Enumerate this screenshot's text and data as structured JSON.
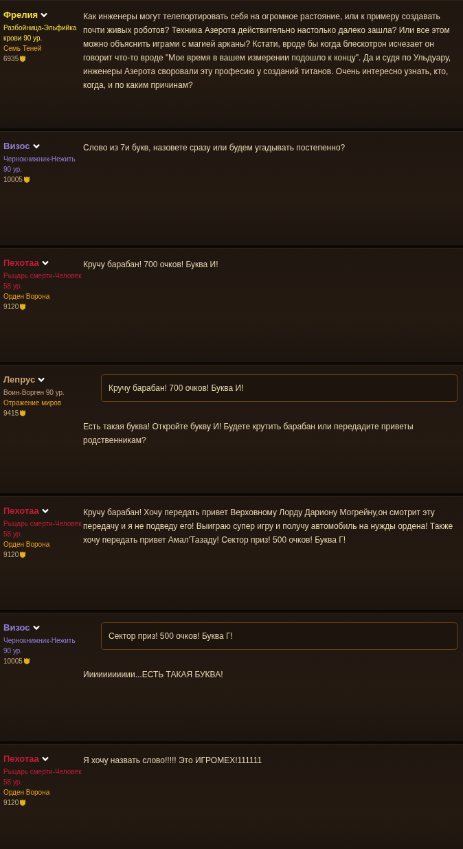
{
  "posts": [
    {
      "author": {
        "name": "Фрелия",
        "color": "#f5e04a",
        "class": "Разбойница-Эльфийка крови 90 ур.",
        "guild": "Семь Теней",
        "points": "6935"
      },
      "body": "Как инженеры могут телепортировать себя на огромное растояние, или к примеру создавать почти живых роботов? Техника Азерота действительно настолько далеко зашла? Или все этом можно объяснить играми с магией арканы? Кстати, вроде бы когда блескотрон исчезает он говорит что-то вроде \"Мое время в вашем измерении подошло к концу\". Да и судя по Ульдуару, инженеры Азерота своровали эту професию у созданий титанов. Очень интересно узнать, кто, когда, и по каким причинам?"
    },
    {
      "author": {
        "name": "Визос",
        "color": "#8f7fd6",
        "class": "Чернокнижник-Нежить 90 ур.",
        "points": "10005"
      },
      "body": "Слово из 7и букв, назовете сразу или будем угадывать постепенно?"
    },
    {
      "author": {
        "name": "Пехотаа",
        "color": "#c41e3a",
        "class": "Рыцарь смерти-Человек 58 ур.",
        "guild": "Орден Ворона",
        "points": "9120"
      },
      "body": "Кручу барабан! 700 очков! Буква И!"
    },
    {
      "author": {
        "name": "Лепрус",
        "color": "#c8a27a",
        "class": "Воин-Ворген 90 ур.",
        "guild": "Отражение миров",
        "points": "9415"
      },
      "quote": "Кручу барабан! 700 очков! Буква И!",
      "body": "Есть такая буква! Откройте букву И! Будете крутить барабан или передадите приветы родственникам?"
    },
    {
      "author": {
        "name": "Пехотаа",
        "color": "#c41e3a",
        "class": "Рыцарь смерти-Человек 58 ур.",
        "guild": "Орден Ворона",
        "points": "9120"
      },
      "body": "Кручу барабан! Хочу передать привет Верховному Лорду Дариону Могрейну,он смотрит эту передачу и я не подведу его! Выиграю супер игру и получу автомобиль на нужды ордена! Также хочу передать привет Амал'Тазаду! Сектор приз! 500 очков! Буква Г!"
    },
    {
      "author": {
        "name": "Визос",
        "color": "#8f7fd6",
        "class": "Чернокнижник-Нежить 90 ур.",
        "points": "10005"
      },
      "quote": "Сектор приз! 500 очков! Буква Г!",
      "body": "Иииииииииии...ЕСТЬ ТАКАЯ БУКВА!"
    },
    {
      "author": {
        "name": "Пехотаа",
        "color": "#c41e3a",
        "class": "Рыцарь смерти-Человек 58 ур.",
        "guild": "Орден Ворона",
        "points": "9120"
      },
      "body": "Я хочу назвать слово!!!!! Это ИГРОМЕХ!111111"
    }
  ]
}
